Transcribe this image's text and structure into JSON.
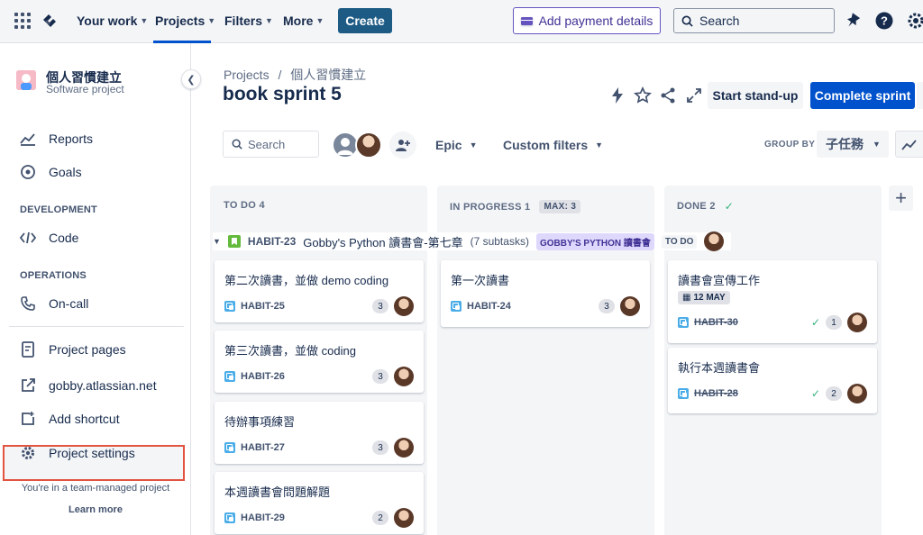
{
  "topnav": {
    "your_work": "Your work",
    "projects": "Projects",
    "filters": "Filters",
    "more": "More",
    "create": "Create",
    "payment": "Add payment details",
    "search_placeholder": "Search",
    "icons": [
      "app-switcher-icon",
      "jira-logo-icon",
      "notifications-icon",
      "help-icon",
      "settings-icon"
    ]
  },
  "sidebar": {
    "project_name": "個人習慣建立",
    "project_type": "Software project",
    "items_top": [
      {
        "label": "Reports",
        "icon": "reports-icon"
      },
      {
        "label": "Goals",
        "icon": "goals-icon"
      }
    ],
    "section_dev": "DEVELOPMENT",
    "code": "Code",
    "section_ops": "OPERATIONS",
    "oncall": "On-call",
    "project_pages": "Project pages",
    "external_link": "gobby.atlassian.net",
    "add_shortcut": "Add shortcut",
    "project_settings": "Project settings",
    "footer_note": "You're in a team-managed project",
    "learn_more": "Learn more"
  },
  "header": {
    "breadcrumb_root": "Projects",
    "breadcrumb_sep": "/",
    "breadcrumb_project": "個人習慣建立",
    "title": "book sprint 5",
    "standup": "Start stand-up",
    "complete": "Complete sprint"
  },
  "toolbar": {
    "search_placeholder": "Search",
    "epic": "Epic",
    "custom_filters": "Custom filters",
    "group_by_label": "GROUP BY",
    "group_by_value": "子任務"
  },
  "columns": [
    {
      "name": "TO DO 4"
    },
    {
      "name": "IN PROGRESS 1",
      "badge": "MAX: 3"
    },
    {
      "name": "DONE 2"
    }
  ],
  "swimlane": {
    "key": "HABIT-23",
    "title": "Gobby's Python 讀書會-第七章",
    "subtasks": "(7 subtasks)",
    "epic": "GOBBY'S PYTHON 讀書會",
    "status": "TO DO"
  },
  "cards": {
    "todo": [
      {
        "title": "第二次讀書，並做 demo coding",
        "key": "HABIT-25",
        "estimate": "3"
      },
      {
        "title": "第三次讀書，並做 coding",
        "key": "HABIT-26",
        "estimate": "3"
      },
      {
        "title": "待辦事項練習",
        "key": "HABIT-27",
        "estimate": "3"
      },
      {
        "title": "本週讀書會問題解題",
        "key": "HABIT-29",
        "estimate": "2"
      }
    ],
    "inprogress": [
      {
        "title": "第一次讀書",
        "key": "HABIT-24",
        "estimate": "3"
      }
    ],
    "done": [
      {
        "title": "讀書會宣傳工作",
        "key": "HABIT-30",
        "estimate": "1",
        "due": "12 MAY"
      },
      {
        "title": "執行本週讀書會",
        "key": "HABIT-28",
        "estimate": "2"
      }
    ]
  },
  "colors": {
    "brand_blue": "#0052cc",
    "create_btn": "#1d5b85",
    "highlight_border": "#e2543f",
    "epic_purple": "#dfd8fd",
    "story_green": "#63ba3c",
    "subtask_blue": "#4bade8"
  }
}
